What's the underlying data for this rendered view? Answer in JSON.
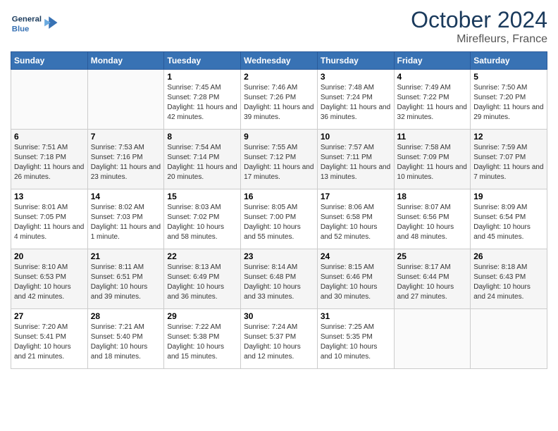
{
  "header": {
    "logo_text_general": "General",
    "logo_text_blue": "Blue",
    "month": "October 2024",
    "location": "Mirefleurs, France"
  },
  "weekdays": [
    "Sunday",
    "Monday",
    "Tuesday",
    "Wednesday",
    "Thursday",
    "Friday",
    "Saturday"
  ],
  "weeks": [
    [
      {
        "day": "",
        "info": ""
      },
      {
        "day": "",
        "info": ""
      },
      {
        "day": "1",
        "info": "Sunrise: 7:45 AM\nSunset: 7:28 PM\nDaylight: 11 hours and 42 minutes."
      },
      {
        "day": "2",
        "info": "Sunrise: 7:46 AM\nSunset: 7:26 PM\nDaylight: 11 hours and 39 minutes."
      },
      {
        "day": "3",
        "info": "Sunrise: 7:48 AM\nSunset: 7:24 PM\nDaylight: 11 hours and 36 minutes."
      },
      {
        "day": "4",
        "info": "Sunrise: 7:49 AM\nSunset: 7:22 PM\nDaylight: 11 hours and 32 minutes."
      },
      {
        "day": "5",
        "info": "Sunrise: 7:50 AM\nSunset: 7:20 PM\nDaylight: 11 hours and 29 minutes."
      }
    ],
    [
      {
        "day": "6",
        "info": "Sunrise: 7:51 AM\nSunset: 7:18 PM\nDaylight: 11 hours and 26 minutes."
      },
      {
        "day": "7",
        "info": "Sunrise: 7:53 AM\nSunset: 7:16 PM\nDaylight: 11 hours and 23 minutes."
      },
      {
        "day": "8",
        "info": "Sunrise: 7:54 AM\nSunset: 7:14 PM\nDaylight: 11 hours and 20 minutes."
      },
      {
        "day": "9",
        "info": "Sunrise: 7:55 AM\nSunset: 7:12 PM\nDaylight: 11 hours and 17 minutes."
      },
      {
        "day": "10",
        "info": "Sunrise: 7:57 AM\nSunset: 7:11 PM\nDaylight: 11 hours and 13 minutes."
      },
      {
        "day": "11",
        "info": "Sunrise: 7:58 AM\nSunset: 7:09 PM\nDaylight: 11 hours and 10 minutes."
      },
      {
        "day": "12",
        "info": "Sunrise: 7:59 AM\nSunset: 7:07 PM\nDaylight: 11 hours and 7 minutes."
      }
    ],
    [
      {
        "day": "13",
        "info": "Sunrise: 8:01 AM\nSunset: 7:05 PM\nDaylight: 11 hours and 4 minutes."
      },
      {
        "day": "14",
        "info": "Sunrise: 8:02 AM\nSunset: 7:03 PM\nDaylight: 11 hours and 1 minute."
      },
      {
        "day": "15",
        "info": "Sunrise: 8:03 AM\nSunset: 7:02 PM\nDaylight: 10 hours and 58 minutes."
      },
      {
        "day": "16",
        "info": "Sunrise: 8:05 AM\nSunset: 7:00 PM\nDaylight: 10 hours and 55 minutes."
      },
      {
        "day": "17",
        "info": "Sunrise: 8:06 AM\nSunset: 6:58 PM\nDaylight: 10 hours and 52 minutes."
      },
      {
        "day": "18",
        "info": "Sunrise: 8:07 AM\nSunset: 6:56 PM\nDaylight: 10 hours and 48 minutes."
      },
      {
        "day": "19",
        "info": "Sunrise: 8:09 AM\nSunset: 6:54 PM\nDaylight: 10 hours and 45 minutes."
      }
    ],
    [
      {
        "day": "20",
        "info": "Sunrise: 8:10 AM\nSunset: 6:53 PM\nDaylight: 10 hours and 42 minutes."
      },
      {
        "day": "21",
        "info": "Sunrise: 8:11 AM\nSunset: 6:51 PM\nDaylight: 10 hours and 39 minutes."
      },
      {
        "day": "22",
        "info": "Sunrise: 8:13 AM\nSunset: 6:49 PM\nDaylight: 10 hours and 36 minutes."
      },
      {
        "day": "23",
        "info": "Sunrise: 8:14 AM\nSunset: 6:48 PM\nDaylight: 10 hours and 33 minutes."
      },
      {
        "day": "24",
        "info": "Sunrise: 8:15 AM\nSunset: 6:46 PM\nDaylight: 10 hours and 30 minutes."
      },
      {
        "day": "25",
        "info": "Sunrise: 8:17 AM\nSunset: 6:44 PM\nDaylight: 10 hours and 27 minutes."
      },
      {
        "day": "26",
        "info": "Sunrise: 8:18 AM\nSunset: 6:43 PM\nDaylight: 10 hours and 24 minutes."
      }
    ],
    [
      {
        "day": "27",
        "info": "Sunrise: 7:20 AM\nSunset: 5:41 PM\nDaylight: 10 hours and 21 minutes."
      },
      {
        "day": "28",
        "info": "Sunrise: 7:21 AM\nSunset: 5:40 PM\nDaylight: 10 hours and 18 minutes."
      },
      {
        "day": "29",
        "info": "Sunrise: 7:22 AM\nSunset: 5:38 PM\nDaylight: 10 hours and 15 minutes."
      },
      {
        "day": "30",
        "info": "Sunrise: 7:24 AM\nSunset: 5:37 PM\nDaylight: 10 hours and 12 minutes."
      },
      {
        "day": "31",
        "info": "Sunrise: 7:25 AM\nSunset: 5:35 PM\nDaylight: 10 hours and 10 minutes."
      },
      {
        "day": "",
        "info": ""
      },
      {
        "day": "",
        "info": ""
      }
    ]
  ]
}
